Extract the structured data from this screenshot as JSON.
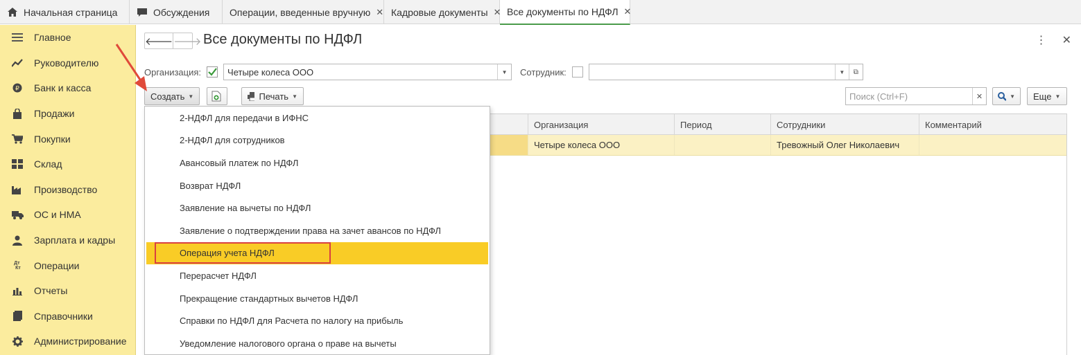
{
  "tabs": [
    {
      "label": "Начальная страница",
      "icon": "home-icon",
      "closable": false
    },
    {
      "label": "Обсуждения",
      "icon": "chat-icon",
      "closable": false
    },
    {
      "label": "Операции, введенные вручную",
      "closable": true
    },
    {
      "label": "Кадровые документы",
      "closable": true
    },
    {
      "label": "Все документы по НДФЛ",
      "closable": true,
      "active": true
    }
  ],
  "sidebar": {
    "items": [
      {
        "label": "Главное",
        "icon": "menu-lines-icon"
      },
      {
        "label": "Руководителю",
        "icon": "trend-icon"
      },
      {
        "label": "Банк и касса",
        "icon": "coin-icon"
      },
      {
        "label": "Продажи",
        "icon": "bag-icon"
      },
      {
        "label": "Покупки",
        "icon": "cart-icon"
      },
      {
        "label": "Склад",
        "icon": "grid-icon"
      },
      {
        "label": "Производство",
        "icon": "factory-icon"
      },
      {
        "label": "ОС и НМА",
        "icon": "truck-icon"
      },
      {
        "label": "Зарплата и кадры",
        "icon": "person-icon"
      },
      {
        "label": "Операции",
        "icon": "dt-kt-icon"
      },
      {
        "label": "Отчеты",
        "icon": "bar-chart-icon"
      },
      {
        "label": "Справочники",
        "icon": "book-icon"
      },
      {
        "label": "Администрирование",
        "icon": "gear-icon"
      }
    ]
  },
  "page": {
    "title": "Все документы по НДФЛ"
  },
  "filters": {
    "org_label": "Организация:",
    "org_checked": true,
    "org_value": "Четыре колеса ООО",
    "employee_label": "Сотрудник:",
    "employee_checked": false,
    "employee_value": ""
  },
  "toolbar": {
    "create_label": "Создать",
    "print_label": "Печать",
    "search_placeholder": "Поиск (Ctrl+F)",
    "more_label": "Еще"
  },
  "table": {
    "columns": [
      "Организация",
      "Период",
      "Сотрудники",
      "Комментарий"
    ],
    "rows": [
      {
        "org": "Четыре колеса ООО",
        "period": "",
        "employees": "Тревожный Олег Николаевич",
        "comment": ""
      }
    ]
  },
  "create_menu": {
    "items": [
      "2-НДФЛ для передачи в ИФНС",
      "2-НДФЛ для сотрудников",
      "Авансовый платеж по НДФЛ",
      "Возврат НДФЛ",
      "Заявление на вычеты по НДФЛ",
      "Заявление о подтверждении права на зачет авансов по НДФЛ",
      "Операция учета НДФЛ",
      "Перерасчет НДФЛ",
      "Прекращение стандартных вычетов НДФЛ",
      "Справки по НДФЛ для Расчета по налогу на прибыль",
      "Уведомление налогового органа о праве на вычеты"
    ],
    "highlighted_index": 6
  },
  "colors": {
    "sidebar_bg": "#fbec9e",
    "highlight": "#f9cc26",
    "annotation_red": "#d94040",
    "row_selected": "#fbf1c4"
  }
}
